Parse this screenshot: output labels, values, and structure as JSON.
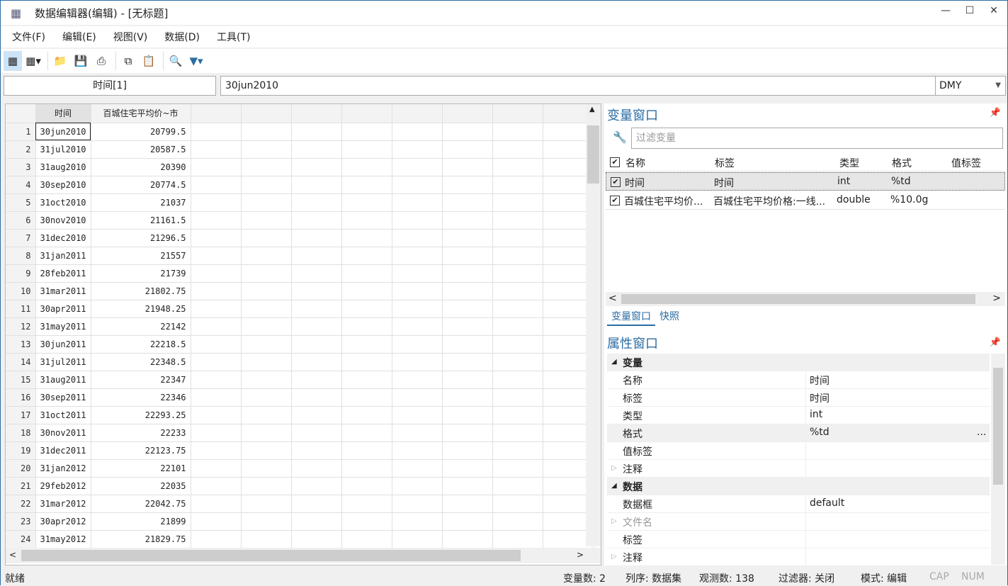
{
  "window": {
    "title": "数据编辑器(编辑) - [无标题]"
  },
  "menu": [
    "文件(F)",
    "编辑(E)",
    "视图(V)",
    "数据(D)",
    "工具(T)"
  ],
  "cell": {
    "name": "时间[1]",
    "value": "30jun2010",
    "format": "DMY"
  },
  "grid": {
    "headers": [
      "时间",
      "百城住宅平均价~市"
    ],
    "rows": [
      [
        "30jun2010",
        "20799.5"
      ],
      [
        "31jul2010",
        "20587.5"
      ],
      [
        "31aug2010",
        "20390"
      ],
      [
        "30sep2010",
        "20774.5"
      ],
      [
        "31oct2010",
        "21037"
      ],
      [
        "30nov2010",
        "21161.5"
      ],
      [
        "31dec2010",
        "21296.5"
      ],
      [
        "31jan2011",
        "21557"
      ],
      [
        "28feb2011",
        "21739"
      ],
      [
        "31mar2011",
        "21802.75"
      ],
      [
        "30apr2011",
        "21948.25"
      ],
      [
        "31may2011",
        "22142"
      ],
      [
        "30jun2011",
        "22218.5"
      ],
      [
        "31jul2011",
        "22348.5"
      ],
      [
        "31aug2011",
        "22347"
      ],
      [
        "30sep2011",
        "22346"
      ],
      [
        "31oct2011",
        "22293.25"
      ],
      [
        "30nov2011",
        "22233"
      ],
      [
        "31dec2011",
        "22123.75"
      ],
      [
        "31jan2012",
        "22101"
      ],
      [
        "29feb2012",
        "22035"
      ],
      [
        "31mar2012",
        "22042.75"
      ],
      [
        "30apr2012",
        "21899"
      ],
      [
        "31may2012",
        "21829.75"
      ]
    ]
  },
  "varwin": {
    "title": "变量窗口",
    "filter_placeholder": "过滤变量",
    "cols": [
      "名称",
      "标签",
      "类型",
      "格式",
      "值标签"
    ],
    "vars": [
      {
        "name": "时间",
        "label": "时间",
        "type": "int",
        "format": "%td"
      },
      {
        "name": "百城住宅平均价...",
        "label": "百城住宅平均价格:一线...",
        "type": "double",
        "format": "%10.0g"
      }
    ],
    "tabs": [
      "变量窗口",
      "快照"
    ]
  },
  "propwin": {
    "title": "属性窗口",
    "rows": [
      {
        "k": "变量",
        "v": "",
        "group": true
      },
      {
        "k": "名称",
        "v": "时间"
      },
      {
        "k": "标签",
        "v": "时间"
      },
      {
        "k": "类型",
        "v": "int"
      },
      {
        "k": "格式",
        "v": "%td",
        "more": "..."
      },
      {
        "k": "值标签",
        "v": ""
      },
      {
        "k": "注释",
        "v": "",
        "exp": true
      },
      {
        "k": "数据",
        "v": "",
        "group": true
      },
      {
        "k": "数据框",
        "v": "default"
      },
      {
        "k": "文件名",
        "v": "",
        "exp": true,
        "dim": true
      },
      {
        "k": "标签",
        "v": ""
      },
      {
        "k": "注释",
        "v": "",
        "exp": true
      }
    ]
  },
  "status": {
    "ready": "就绪",
    "vars": "变量数: 2",
    "order": "列序: 数据集",
    "obs": "观测数: 138",
    "filter": "过滤器: 关闭",
    "mode": "模式: 编辑",
    "cap": "CAP",
    "num": "NUM"
  }
}
